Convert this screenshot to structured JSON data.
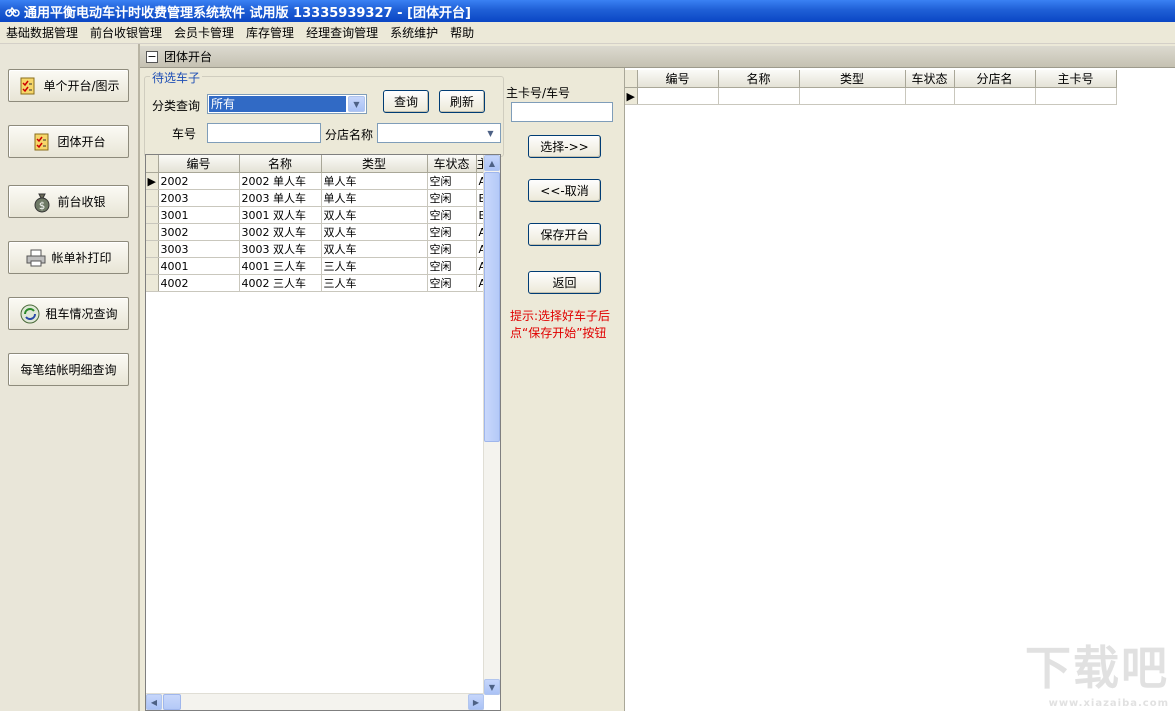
{
  "window": {
    "title": "通用平衡电动车计时收费管理系统软件  试用版  13335939327   -  [团体开台]"
  },
  "menu": [
    "基础数据管理",
    "前台收银管理",
    "会员卡管理",
    "库存管理",
    "经理查询管理",
    "系统维护",
    "帮助"
  ],
  "sidebar": {
    "items": [
      {
        "label": "单个开台/图示",
        "icon": "checklist-icon"
      },
      {
        "label": "团体开台",
        "icon": "checklist-icon"
      },
      {
        "label": "前台收银",
        "icon": "money-bag-icon"
      },
      {
        "label": "帐单补打印",
        "icon": "printer-icon"
      },
      {
        "label": "租车情况查询",
        "icon": "refresh-globe-icon"
      },
      {
        "label": "每笔结帐明细查询",
        "icon": ""
      }
    ]
  },
  "panel": {
    "title": "团体开台"
  },
  "filter": {
    "group_title": "待选车子",
    "category_label": "分类查询",
    "category_value": "所有",
    "query_button": "查询",
    "refresh_button": "刷新",
    "car_no_label": "车号",
    "car_no_value": "",
    "branch_label": "分店名称",
    "branch_value": ""
  },
  "left_grid": {
    "columns": [
      "编号",
      "名称",
      "类型",
      "车状态",
      "主"
    ],
    "rows": [
      [
        "2002",
        "2002 单人车",
        "单人车",
        "空闲",
        "A"
      ],
      [
        "2003",
        "2003 单人车",
        "单人车",
        "空闲",
        "B"
      ],
      [
        "3001",
        "3001 双人车",
        "双人车",
        "空闲",
        "B"
      ],
      [
        "3002",
        "3002 双人车",
        "双人车",
        "空闲",
        "A"
      ],
      [
        "3003",
        "3003 双人车",
        "双人车",
        "空闲",
        "A"
      ],
      [
        "4001",
        "4001 三人车",
        "三人车",
        "空闲",
        "A"
      ],
      [
        "4002",
        "4002 三人车",
        "三人车",
        "空闲",
        "A"
      ]
    ]
  },
  "middle": {
    "main_card_label": "主卡号/车号",
    "main_card_value": "",
    "select_button": "选择->>",
    "cancel_button": "<<-取消",
    "save_button": "保存开台",
    "back_button": "返回",
    "hint": "提示:选择好车子后点“保存开始”按钮"
  },
  "right_grid": {
    "columns": [
      "编号",
      "名称",
      "类型",
      "车状态",
      "分店名",
      "主卡号"
    ]
  },
  "watermark": {
    "text": "下载吧",
    "sub": "www.xiazaiba.com"
  }
}
